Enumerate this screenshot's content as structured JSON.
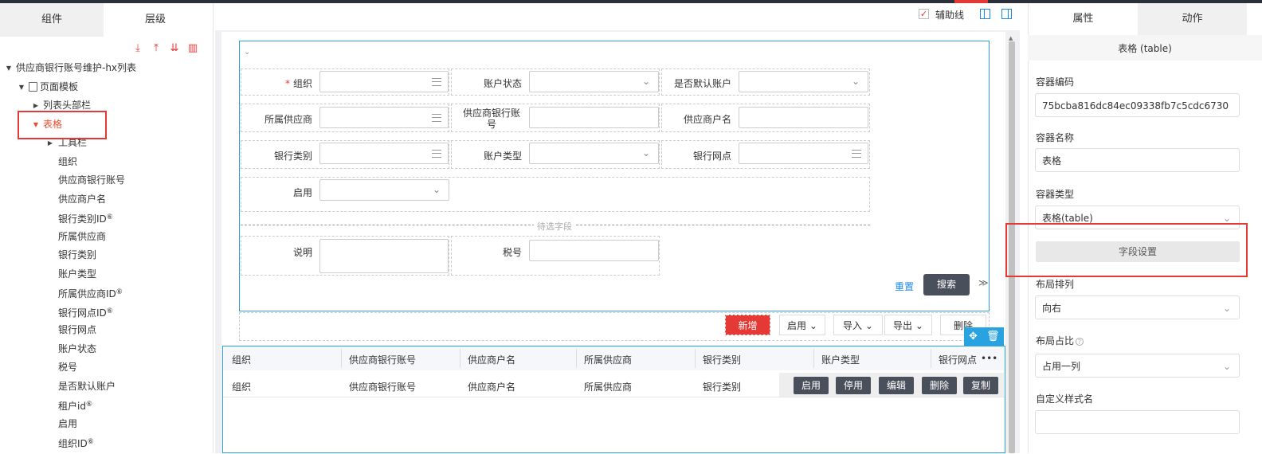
{
  "left_panel": {
    "tabs": [
      "组件",
      "层级"
    ],
    "tree": [
      {
        "label": "供应商银行账号维护-hx列表",
        "level": 0,
        "arrow": "open"
      },
      {
        "label": "页面模板",
        "level": 1,
        "arrow": "open",
        "icon": "page-icon"
      },
      {
        "label": "列表头部栏",
        "level": 2,
        "arrow": "closed"
      },
      {
        "label": "表格",
        "level": 2,
        "arrow": "open",
        "selected": true
      },
      {
        "label": "工具栏",
        "level": 3,
        "arrow": "closed"
      },
      {
        "label": "组织",
        "level": 3
      },
      {
        "label": "供应商银行账号",
        "level": 3
      },
      {
        "label": "供应商户名",
        "level": 3
      },
      {
        "label": "银行类别ID",
        "level": 3,
        "badge": true
      },
      {
        "label": "所属供应商",
        "level": 3
      },
      {
        "label": "银行类别",
        "level": 3
      },
      {
        "label": "账户类型",
        "level": 3
      },
      {
        "label": "所属供应商ID",
        "level": 3,
        "badge": true
      },
      {
        "label": "银行网点ID",
        "level": 3,
        "badge": true
      },
      {
        "label": "银行网点",
        "level": 3
      },
      {
        "label": "账户状态",
        "level": 3
      },
      {
        "label": "税号",
        "level": 3
      },
      {
        "label": "是否默认账户",
        "level": 3
      },
      {
        "label": "租户id",
        "level": 3,
        "badge": true
      },
      {
        "label": "启用",
        "level": 3
      },
      {
        "label": "组织ID",
        "level": 3,
        "badge": true
      }
    ],
    "badge_glyph": "⑥"
  },
  "canvas_top": {
    "guide_label": "辅助线",
    "guide_checked": "✓"
  },
  "form": {
    "fields": {
      "org": "组织",
      "account_status": "账户状态",
      "is_default": "是否默认账户",
      "supplier": "所属供应商",
      "bank_account": "供应商银行账号",
      "account_name": "供应商户名",
      "bank_type": "银行类别",
      "account_type": "账户类型",
      "bank_branch": "银行网点",
      "enabled": "启用",
      "desc": "说明",
      "tax_no": "税号"
    },
    "required_mark": "*",
    "pending_label": "待选字段",
    "reset": "重置",
    "search": "搜索",
    "expand": "≫"
  },
  "toolbar": {
    "new": "新增",
    "enable": "启用",
    "import": "导入",
    "export": "导出",
    "delete": "删除"
  },
  "table": {
    "columns": [
      "组织",
      "供应商银行账号",
      "供应商户名",
      "所属供应商",
      "银行类别",
      "账户类型",
      "银行网点"
    ],
    "more": "•••",
    "row": [
      "组织",
      "供应商银行账号",
      "供应商户名",
      "所属供应商",
      "银行类别"
    ],
    "row_actions": [
      "启用",
      "停用",
      "编辑",
      "删除",
      "复制"
    ]
  },
  "right_panel": {
    "tabs": [
      "属性",
      "动作"
    ],
    "title": "表格 (table)",
    "container_code_label": "容器编码",
    "container_code": "75bcba816dc84ec09338fb7c5cdc6730",
    "container_name_label": "容器名称",
    "container_name": "表格",
    "container_type_label": "容器类型",
    "container_type": "表格(table)",
    "field_settings": "字段设置",
    "layout_label": "布局排列",
    "layout": "向右",
    "ratio_label": "布局占比",
    "ratio": "占用一列",
    "custom_style_label": "自定义样式名",
    "custom_style": ""
  }
}
